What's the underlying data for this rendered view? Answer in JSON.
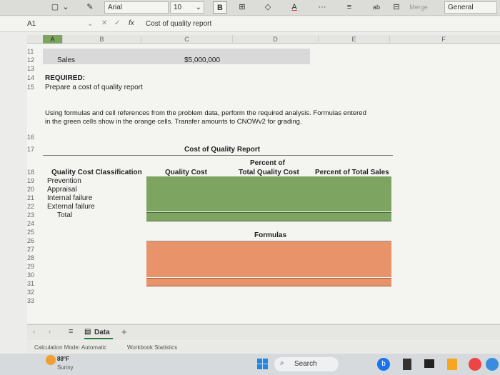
{
  "ribbon": {
    "font_name": "Arial",
    "font_size": "10",
    "bold_label": "B",
    "font_color_label": "A",
    "more_label": "···",
    "merge_label": "Merge",
    "number_format": "General"
  },
  "formula_bar": {
    "name_box": "A1",
    "fx_label": "fx",
    "content": "Cost of quality report"
  },
  "columns": [
    "A",
    "B",
    "C",
    "D",
    "E",
    "F"
  ],
  "rows": {
    "r11": "11",
    "r12": "12",
    "r13": "13",
    "r14": "14",
    "r15": "15",
    "r16": "16",
    "r17": "17",
    "r18": "18",
    "r19": "19",
    "r20": "20",
    "r21": "21",
    "r22": "22",
    "r23": "23",
    "r24": "24",
    "r25": "25",
    "r26": "26",
    "r27": "27",
    "r28": "28",
    "r29": "29",
    "r30": "30",
    "r31": "31",
    "r32": "32",
    "r33": "33"
  },
  "sheet": {
    "sales_label": "Sales",
    "sales_value": "$5,000,000",
    "required_label": "REQUIRED:",
    "required_text": "Prepare a cost of quality report",
    "instructions_line1": "Using formulas and cell references from the problem data, perform the required analysis. Formulas entered",
    "instructions_line2": "in the green cells show in the orange cells. Transfer amounts to CNOWv2 for grading.",
    "report_title": "Cost of Quality Report",
    "hdr_classification": "Quality Cost Classification",
    "hdr_quality_cost": "Quality Cost",
    "hdr_percent_total_quality_1": "Percent of",
    "hdr_percent_total_quality_2": "Total Quality Cost",
    "hdr_percent_total_sales": "Percent of Total Sales",
    "cat_prevention": "Prevention",
    "cat_appraisal": "Appraisal",
    "cat_internal": "Internal failure",
    "cat_external": "External failure",
    "cat_total": "Total",
    "formulas_label": "Formulas"
  },
  "tabs": {
    "sheet_tab": "Data",
    "add_label": "+"
  },
  "status": {
    "calc_mode": "Calculation Mode: Automatic",
    "workbook_stats": "Workbook Statistics"
  },
  "taskbar": {
    "weather_temp": "88°F",
    "weather_desc": "Sunny",
    "search_label": "Search"
  },
  "colors": {
    "green_fill": "#7da561",
    "orange_fill": "#e8936a",
    "sales_band": "#d9d9d9",
    "accent_blue": "#1a73e8"
  }
}
